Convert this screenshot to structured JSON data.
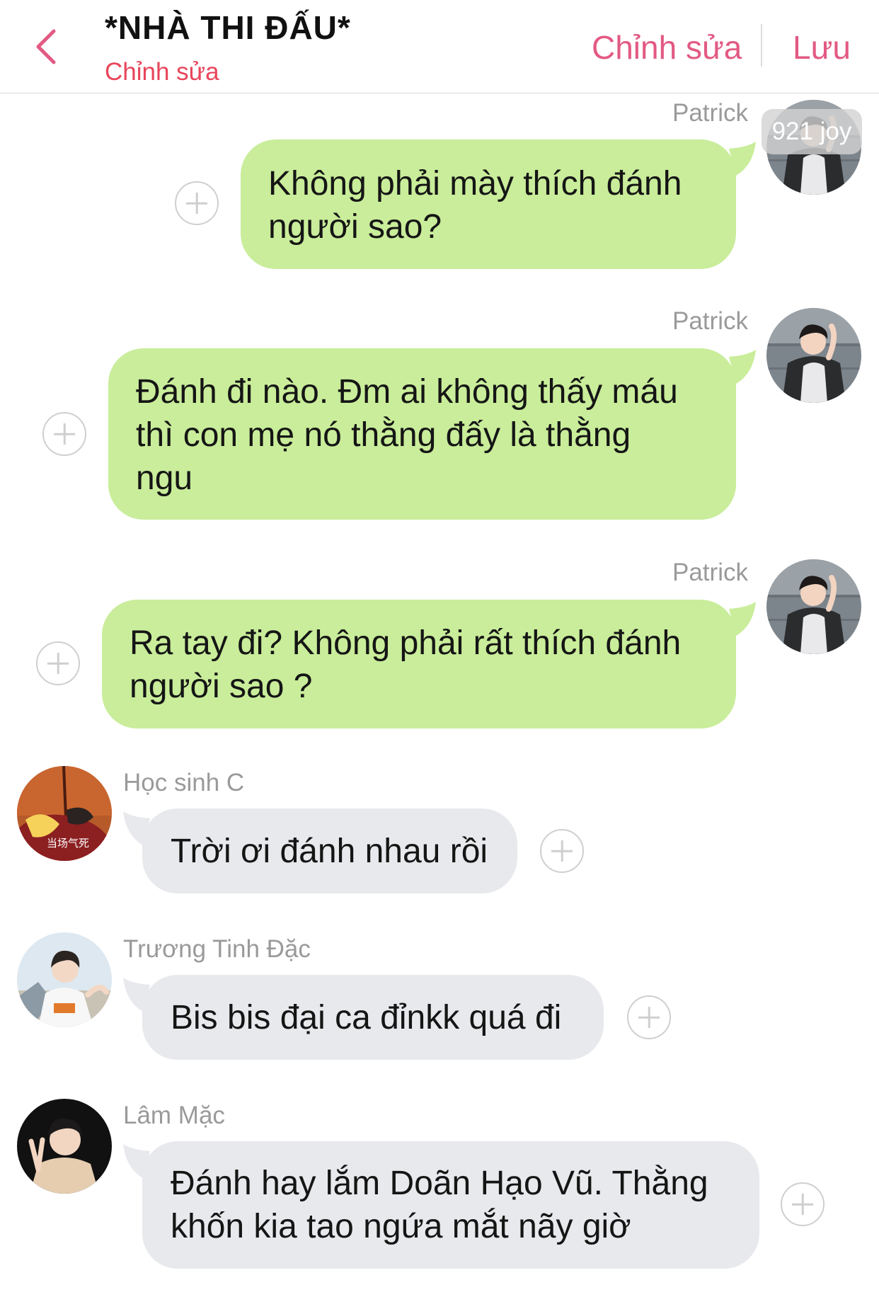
{
  "header": {
    "title": "*NHÀ THI ĐẤU*",
    "subtitle": "Chỉnh sửa",
    "edit_label": "Chỉnh sửa",
    "save_label": "Lưu"
  },
  "colors": {
    "accent": "#e25a83",
    "bubble_right": "#c9ed9a",
    "bubble_left": "#e8e9ec"
  },
  "watermark": "921 joy",
  "messages": [
    {
      "sender": "Patrick",
      "side": "right",
      "lines": [
        "Không phải mày thích đánh",
        "người sao?"
      ]
    },
    {
      "sender": "Patrick",
      "side": "right",
      "lines": [
        "Đánh đi nào. Đm ai không thấy máu",
        "thì con mẹ nó thằng đấy là thằng",
        "ngu"
      ]
    },
    {
      "sender": "Patrick",
      "side": "right",
      "lines": [
        "Ra tay đi? Không phải rất thích đánh",
        "người sao ?"
      ]
    },
    {
      "sender": "Học sinh C",
      "side": "left",
      "avatar_text": "当场气死",
      "lines": [
        "Trời ơi đánh nhau rồi"
      ]
    },
    {
      "sender": "Trương Tinh Đặc",
      "side": "left",
      "lines": [
        "Bis bis đại ca đỉnkk quá đi"
      ]
    },
    {
      "sender": "Lâm Mặc",
      "side": "left",
      "lines": [
        "Đánh hay lắm Doãn Hạo Vũ. Thằng",
        "khốn kia tao ngứa mắt nãy giờ"
      ]
    }
  ]
}
